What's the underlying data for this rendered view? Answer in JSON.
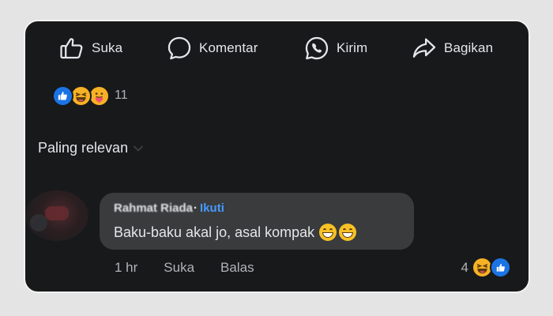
{
  "actions": {
    "like_label": "Suka",
    "comment_label": "Komentar",
    "send_label": "Kirim",
    "share_label": "Bagikan"
  },
  "reactions": {
    "types": [
      "like",
      "haha",
      "care"
    ],
    "count": "11"
  },
  "sort": {
    "label": "Paling relevan"
  },
  "comment": {
    "author": "Rahmat Riada",
    "separator": "·",
    "follow_label": "Ikuti",
    "text": "Baku-baku akal jo, asal kompak",
    "time": "1 hr",
    "like_label": "Suka",
    "reply_label": "Balas",
    "reaction_count": "4",
    "reaction_types": [
      "haha",
      "like"
    ]
  },
  "colors": {
    "background": "#18191a",
    "bubble": "#3a3b3c",
    "accent": "#4599ff",
    "like_blue": "#1b74e4",
    "emoji_yellow": "#f7b125"
  }
}
